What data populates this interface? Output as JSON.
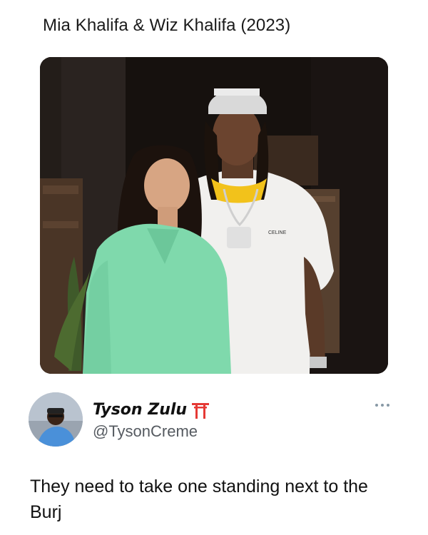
{
  "caption": "Mia Khalifa & Wiz Khalifa (2023)",
  "photo": {
    "shirt_text": "CELINE"
  },
  "tweet": {
    "display_name": "Tyson Zulu",
    "badge_icon": "torii-gate-icon",
    "handle": "@TysonCreme",
    "text": "They need to take one standing next to the Burj"
  },
  "colors": {
    "background": "#ffffff",
    "torii_red": "#e53935",
    "handle_gray": "#555a60"
  }
}
